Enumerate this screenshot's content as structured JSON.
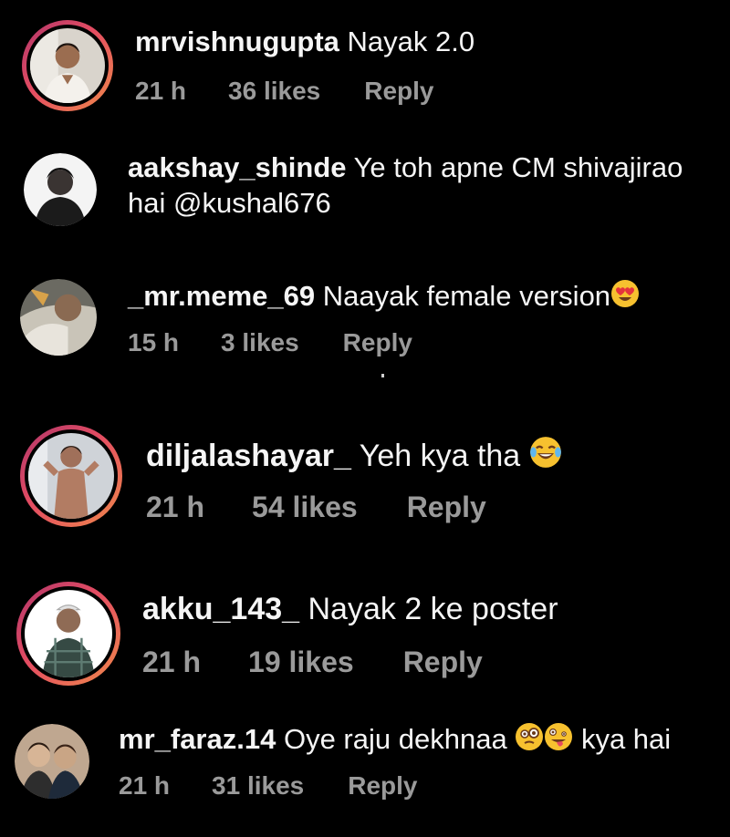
{
  "comments": [
    {
      "username": "mrvishnugupta",
      "text": "Nayak 2.0",
      "time": "21 h",
      "likes": "36 likes",
      "reply": "Reply",
      "has_story_ring": true
    },
    {
      "username": "aakshay_shinde",
      "text": "Ye toh apne CM shivajirao",
      "text_line2": "hai @kushal676",
      "has_story_ring": false
    },
    {
      "username": "_mr.meme_69",
      "text": "Naayak female version",
      "emoji": "heart-eyes-emoji",
      "time": "15 h",
      "likes": "3 likes",
      "reply": "Reply",
      "has_story_ring": false
    },
    {
      "username": "diljalashayar_",
      "text": "Yeh kya tha",
      "emoji": "tears-of-joy-emoji",
      "time": "21 h",
      "likes": "54 likes",
      "reply": "Reply",
      "has_story_ring": true
    },
    {
      "username": "akku_143_",
      "text": "Nayak 2 ke poster",
      "time": "21 h",
      "likes": "19 likes",
      "reply": "Reply",
      "has_story_ring": true
    },
    {
      "username": "mr_faraz.14",
      "text": "Oye raju dekhnaa",
      "emoji": "zany-face-emoji",
      "text_after_emoji": "kya hai",
      "time": "21 h",
      "likes": "31 likes",
      "reply": "Reply",
      "has_story_ring": false
    }
  ],
  "colors": {
    "background": "#000000",
    "text": "#f5f5f5",
    "meta": "#9a9a9a",
    "ring_start": "#b1366b",
    "ring_end": "#f08a4b"
  }
}
